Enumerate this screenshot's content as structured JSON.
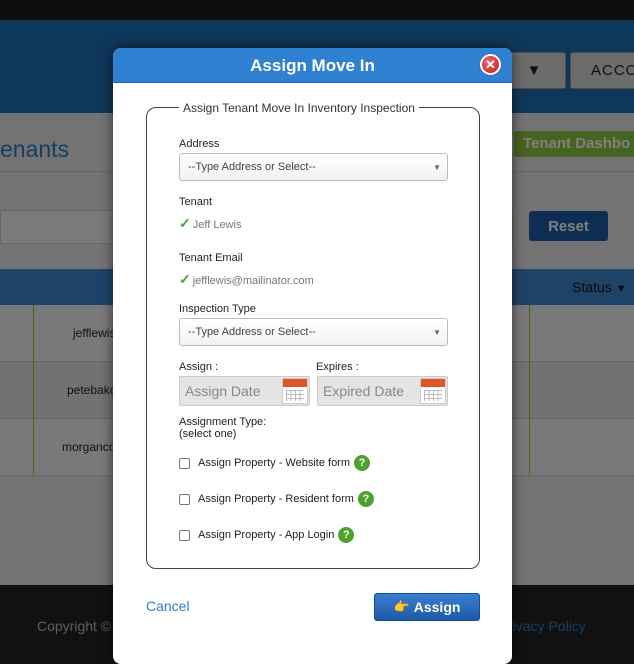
{
  "background": {
    "header_dropdown_icon": "▼",
    "account_label": "ACCO",
    "page_title": "enants",
    "dashboard_button": "Tenant Dashbo",
    "reset_button": "Reset",
    "status_column": "Status",
    "status_sort_icon": "▼",
    "rows": [
      "jefflewis",
      "petebako",
      "morganco"
    ],
    "copyright": "Copyright ©",
    "privacy": "rivacy Policy"
  },
  "modal": {
    "title": "Assign Move In",
    "close_icon": "✕",
    "legend": "Assign Tenant Move In Inventory Inspection",
    "address": {
      "label": "Address",
      "placeholder": "--Type Address or Select--"
    },
    "tenant": {
      "label": "Tenant",
      "value": "Jeff Lewis"
    },
    "tenant_email": {
      "label": "Tenant Email",
      "value": "jefflewis@mailinator.com"
    },
    "inspection_type": {
      "label": "Inspection Type",
      "placeholder": "--Type Address or Select--"
    },
    "assign": {
      "label": "Assign :",
      "placeholder": "Assign Date"
    },
    "expires": {
      "label": "Expires :",
      "placeholder": "Expired Date"
    },
    "assignment_type": {
      "label_line1": "Assignment Type:",
      "label_line2": "(select one)",
      "options": [
        "Assign Property - Website form",
        "Assign Property - Resident form",
        "Assign Property - App Login"
      ]
    },
    "help_icon": "?",
    "cancel_label": "Cancel",
    "assign_button": "Assign",
    "check_glyph": "✓",
    "hand_glyph": "👉"
  },
  "colors": {
    "primary_blue": "#2f80d1",
    "accent_green": "#8cc63f",
    "close_red": "#c61717"
  }
}
